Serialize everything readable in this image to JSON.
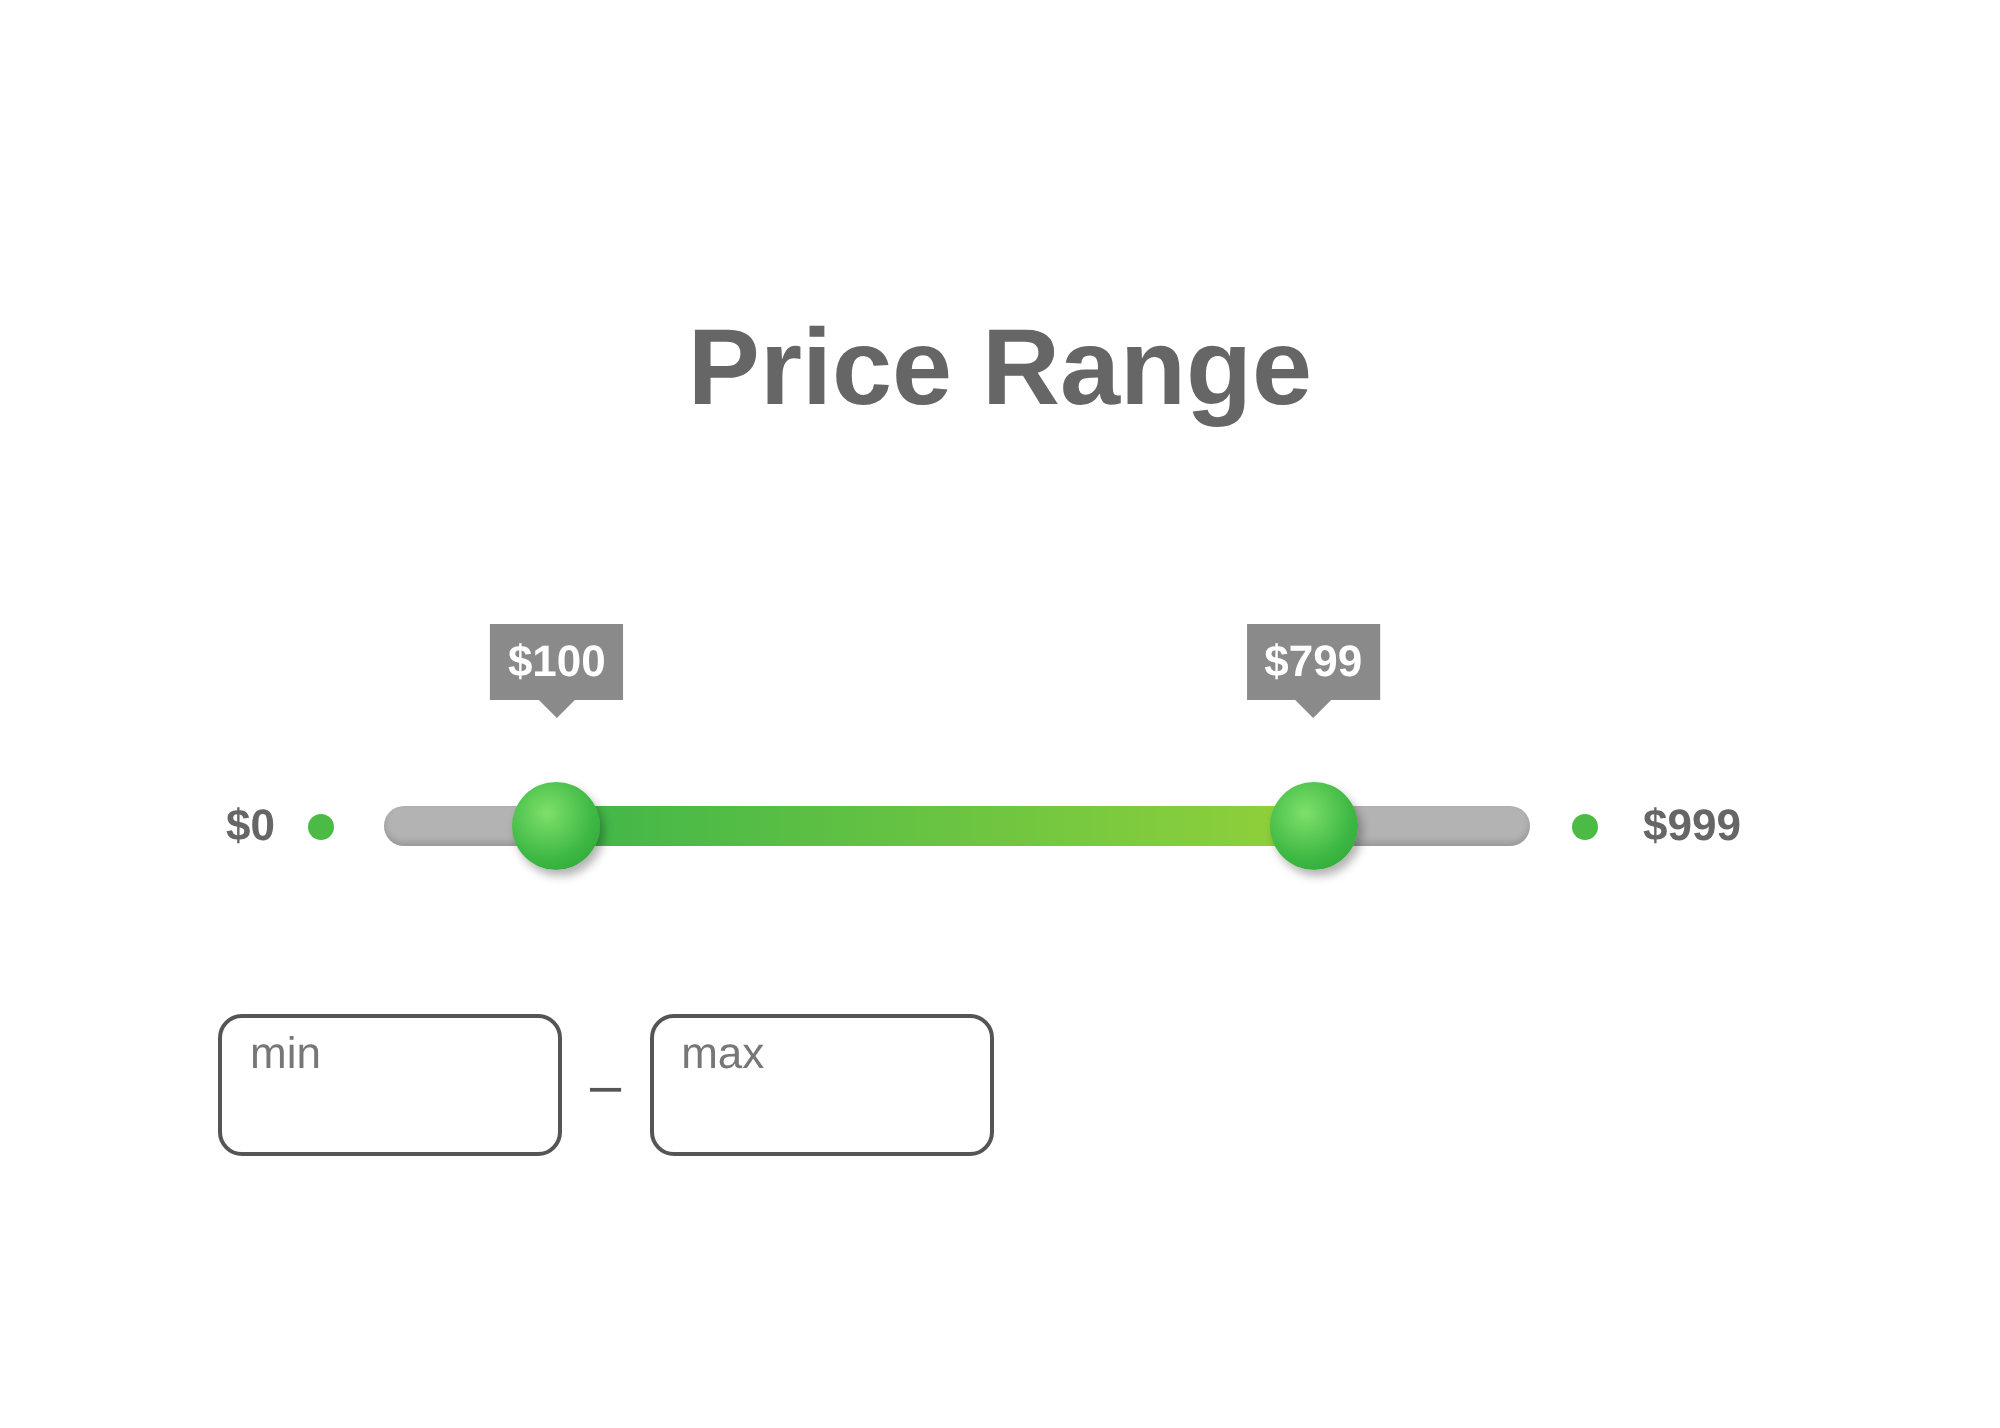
{
  "title": "Price Range",
  "slider": {
    "min_label": "$0",
    "max_label": "$999",
    "thumbs": [
      {
        "label": "$100",
        "level": 0.15
      },
      {
        "label": "$799",
        "level": 0.81
      }
    ]
  },
  "inputs": [
    {
      "placeholder": "min"
    },
    {
      "placeholder": "max"
    }
  ],
  "separator": "–"
}
